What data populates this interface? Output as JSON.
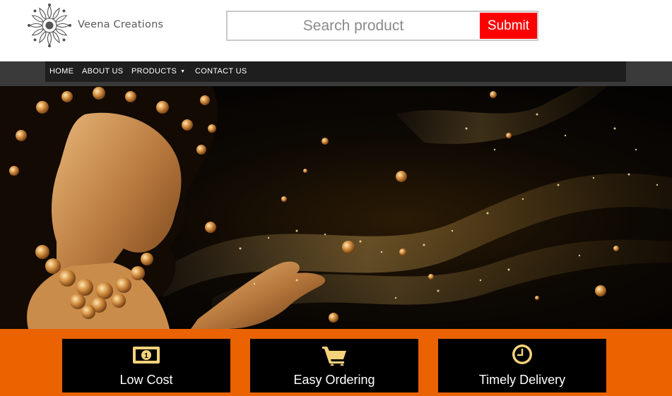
{
  "header": {
    "brand_name": "Veena Creations",
    "logo_icon": "mandala-logo-icon"
  },
  "search": {
    "placeholder": "Search product",
    "value": "",
    "submit_label": "Submit"
  },
  "nav": {
    "items": [
      {
        "label": "HOME"
      },
      {
        "label": "ABOUT US"
      },
      {
        "label": "PRODUCTS",
        "has_dropdown": true
      },
      {
        "label": "CONTACT US"
      }
    ]
  },
  "hero": {
    "image": "woman-gold-jewelry-banner"
  },
  "features": [
    {
      "label": "Low Cost",
      "icon": "money-icon"
    },
    {
      "label": "Easy Ordering",
      "icon": "cart-icon"
    },
    {
      "label": "Timely Delivery",
      "icon": "clock-icon"
    }
  ],
  "colors": {
    "submit": "#ff0000",
    "features_bg": "#ea6300",
    "nav_bg": "#1e1e1e",
    "icon_gold": "#f4d27a"
  }
}
